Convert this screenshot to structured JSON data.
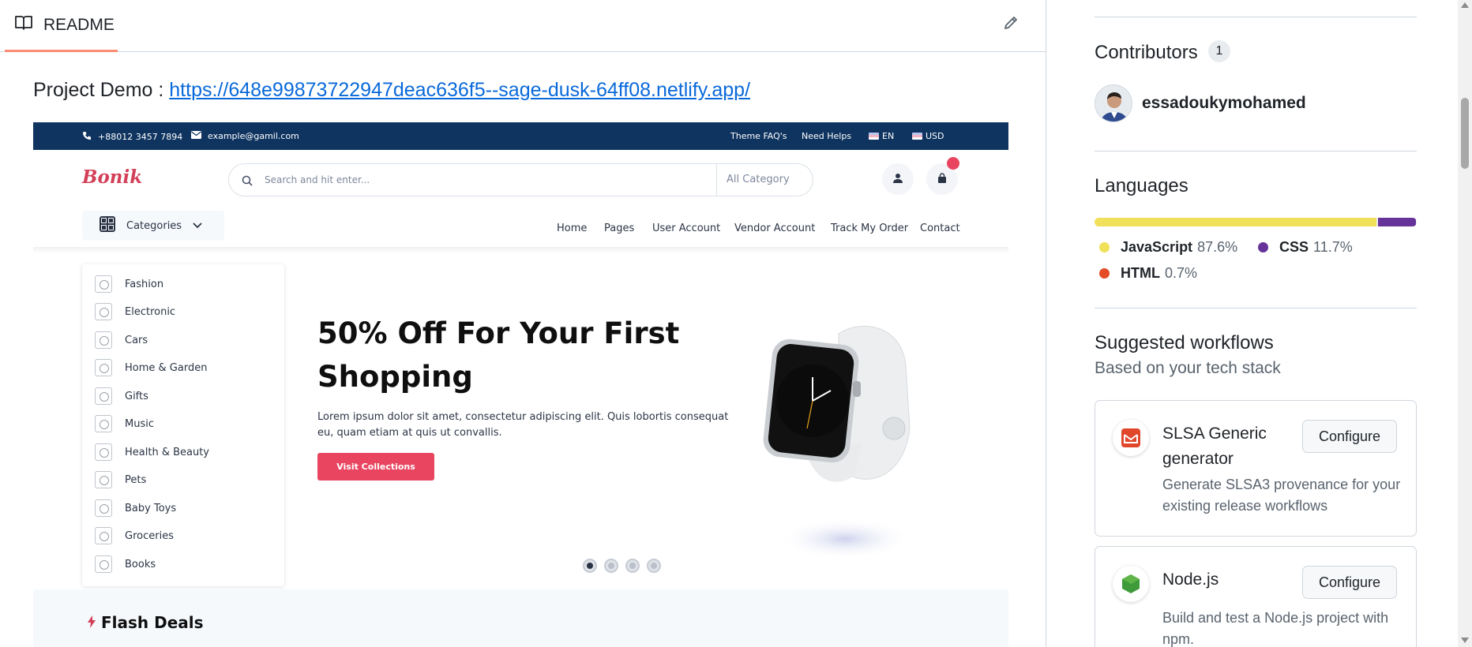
{
  "readme": {
    "tab_label": "README",
    "demo_prefix": "Project Demo : ",
    "demo_link": "https://648e99873722947deac636f5--sage-dusk-64ff08.netlify.app/"
  },
  "demo_site": {
    "phone": "+88012 3457 7894",
    "email": "example@gamil.com",
    "top_links": [
      "Theme FAQ's",
      "Need Helps"
    ],
    "language": "EN",
    "currency": "USD",
    "logo": "Bonik",
    "search_placeholder": "Search and hit enter...",
    "search_category": "All Category",
    "categories_button": "Categories",
    "nav": [
      "Home",
      "Pages",
      "User Account",
      "Vendor Account",
      "Track My Order",
      "Contact"
    ],
    "category_list": [
      "Fashion",
      "Electronic",
      "Cars",
      "Home & Garden",
      "Gifts",
      "Music",
      "Health & Beauty",
      "Pets",
      "Baby Toys",
      "Groceries",
      "Books"
    ],
    "hero_title": "50% Off For Your First Shopping",
    "hero_text": "Lorem ipsum dolor sit amet, consectetur adipiscing elit. Quis lobortis consequat eu, quam etiam at quis ut convallis.",
    "hero_button": "Visit Collections",
    "carousel_active_index": 0,
    "flash_deals_title": "Flash Deals"
  },
  "sidebar": {
    "contributors_title": "Contributors",
    "contributors_count": "1",
    "contributor_name": "essadoukymohamed",
    "languages_title": "Languages",
    "languages": [
      {
        "name": "JavaScript",
        "percent": "87.6%",
        "value": 87.6,
        "color": "#f1e05a"
      },
      {
        "name": "CSS",
        "percent": "11.7%",
        "value": 11.7,
        "color": "#663399"
      },
      {
        "name": "HTML",
        "percent": "0.7%",
        "value": 0.7,
        "color": "#e34c26"
      }
    ],
    "workflows_title": "Suggested workflows",
    "workflows_subtitle": "Based on your tech stack",
    "workflows": [
      {
        "title": "SLSA Generic generator",
        "description": "Generate SLSA3 provenance for your existing release workflows",
        "button": "Configure"
      },
      {
        "title": "Node.js",
        "description": "Build and test a Node.js project with npm.",
        "button": "Configure"
      }
    ]
  },
  "colors": {
    "link": "#0969da",
    "tab_underline": "#fd8c73",
    "demo_topbar": "#0f3460",
    "demo_accent": "#e94560"
  }
}
